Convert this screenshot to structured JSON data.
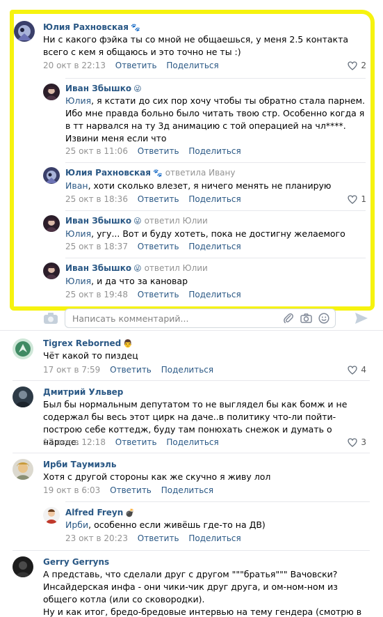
{
  "colors": {
    "highlight": "#f6f30f",
    "link": "#2a5885",
    "meta": "#939393"
  },
  "thread": {
    "c1": {
      "author": "Юлия Рахновская",
      "emoji": "🐾",
      "text": "Ни с какого фэйка ты со мной не общаешься, у меня 2.5 контакта всего с кем я общаюсь и это точно не ты :)",
      "date": "20 окт в 22:13",
      "likes": "2"
    },
    "r1": {
      "author": "Иван Збышко",
      "emoji": "😜",
      "addressee": "Юлия",
      "text": ", я кстати до сих пор хочу чтобы ты обратно стала парнем. Ибо мне правда больно было читать твою стр. Особенно когда я в тт нарвался на ту 3д анимацию с той операцией на чл****. Извини меня если что",
      "date": "25 окт в 11:06"
    },
    "r2": {
      "author": "Юлия Рахновская",
      "emoji": "🐾",
      "reply_to": "ответила Ивану",
      "addressee": "Иван",
      "text": ", хоти сколько влезет, я ничего менять не планирую",
      "date": "25 окт в 18:36",
      "likes": "1"
    },
    "r3": {
      "author": "Иван Збышко",
      "emoji": "😜",
      "reply_to": "ответил Юлии",
      "addressee": "Юлия",
      "text": ", угу... Вот и буду хотеть, пока не достигну желаемого",
      "date": "25 окт в 18:37"
    },
    "r4": {
      "author": "Иван Збышко",
      "emoji": "😜",
      "reply_to": "ответил Юлии",
      "addressee": "Юлия",
      "text": ", и да что за кановар",
      "date": "25 окт в 19:48"
    }
  },
  "comment_input": {
    "placeholder": "Написать комментарий..."
  },
  "actions": {
    "reply": "Ответить",
    "share": "Поделиться"
  },
  "comments": {
    "c2": {
      "author": "Tigrex Reborned",
      "emoji": "👨",
      "text": "Чёт какой то пиздец",
      "date": "17 окт в 7:59",
      "likes": "4"
    },
    "c3": {
      "author": "Дмитрий Ульвер",
      "text": "Был бы нормальным депутатом то не выглядел бы как бомж и не содержал бы весь этот цирк на даче..в политику что-ли пойти- построю себе коттедж, буду там понюхать снежок и думать о народе.",
      "date": "17 окт в 12:18",
      "likes": "3"
    },
    "c4": {
      "author": "Ирби Таумиэль",
      "text": "Хотя с другой стороны как же скучно я живу лол",
      "date": "19 окт в 6:03"
    },
    "r5": {
      "author": "Alfred Freyn",
      "emoji": "💣",
      "addressee": "Ирби",
      "text": ", особенно если живёшь где-то на ДВ)",
      "date": "23 окт в 20:23"
    },
    "c5": {
      "author": "Gerry Gerryns",
      "text": "А представь, что сделали друг с другом \"\"\"братья\"\"\" Вачовски? Инсайдерская инфа - они чики-чик друг друга, и ом-ном-ном из общего котла (или со сковородки).",
      "text2": "Ну и как итог, бредо-бредовые интервью на тему гендера (смотрю в"
    }
  }
}
